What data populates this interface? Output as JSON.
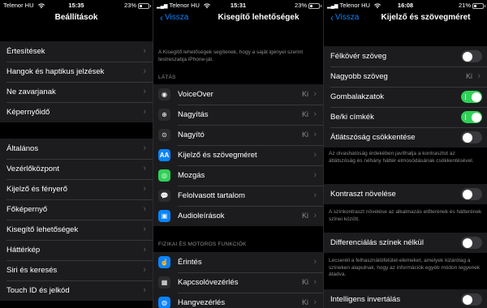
{
  "panel1": {
    "status": {
      "carrier": "Telenor HU",
      "time": "15:35",
      "battery": "23%",
      "battery_level": 0.23
    },
    "title": "Beállítások",
    "group1": [
      "Értesítések",
      "Hangok és haptikus jelzések",
      "Ne zavarjanak",
      "Képernyőidő"
    ],
    "group2": [
      "Általános",
      "Vezérlőközpont",
      "Kijelző és fényerő",
      "Főképernyő",
      "Kisegítő lehetőségek",
      "Háttérkép",
      "Siri és keresés",
      "Touch ID és jelkód"
    ]
  },
  "panel2": {
    "status": {
      "carrier": "Telenor HU",
      "time": "15:31",
      "battery": "23%",
      "battery_level": 0.23
    },
    "back": "Vissza",
    "title": "Kisegítő lehetőségek",
    "intro": "A Kisegítő lehetőségek segítenek, hogy a saját igényei szerint testreszabja iPhone-ját.",
    "section_vision": "LÁTÁS",
    "vision_items": [
      {
        "label": "VoiceOver",
        "value": "Ki",
        "icon": "voiceover-icon"
      },
      {
        "label": "Nagyítás",
        "value": "Ki",
        "icon": "zoom-icon"
      },
      {
        "label": "Nagyító",
        "value": "Ki",
        "icon": "magnifier-icon"
      },
      {
        "label": "Kijelző és szövegméret",
        "value": "",
        "icon": "text-size-icon"
      },
      {
        "label": "Mozgás",
        "value": "",
        "icon": "motion-icon"
      },
      {
        "label": "Felolvasott tartalom",
        "value": "",
        "icon": "speech-icon"
      },
      {
        "label": "Audioleírások",
        "value": "Ki",
        "icon": "audio-description-icon"
      }
    ],
    "section_motor": "FIZIKAI ÉS MOTOROS FUNKCIÓK",
    "motor_items": [
      {
        "label": "Érintés",
        "value": "",
        "icon": "touch-icon"
      },
      {
        "label": "Kapcsolóvezérlés",
        "value": "Ki",
        "icon": "switch-control-icon"
      },
      {
        "label": "Hangvezérlés",
        "value": "Ki",
        "icon": "voice-control-icon"
      }
    ]
  },
  "panel3": {
    "status": {
      "carrier": "Telenor HU",
      "time": "16:08",
      "battery": "21%",
      "battery_level": 0.21
    },
    "back": "Vissza",
    "title": "Kijelző és szövegméret",
    "group1": {
      "bold": {
        "label": "Félkövér szöveg",
        "on": false
      },
      "larger": {
        "label": "Nagyobb szöveg",
        "value": "Ki"
      },
      "button_shapes": {
        "label": "Gombalakzatok",
        "on": true
      },
      "onoff_labels": {
        "label": "Be/ki címkék",
        "on": true
      },
      "reduce_transparency": {
        "label": "Átlátszóság csökkentése",
        "on": false
      }
    },
    "desc_transparency": "Az olvashatóság érdekében javíthatja a kontrasztot az átlátszóság és néhány háttér elmosódásának csökkentésével.",
    "contrast": {
      "label": "Kontraszt növelése",
      "on": false
    },
    "desc_contrast": "A színkontraszt növelése az alkalmazás előterének és hátterének színei között.",
    "differentiate": {
      "label": "Differenciálás színek nélkül",
      "on": false
    },
    "desc_differentiate": "Lecseréli a felhasználóifelület-elemeket, amelyek kizárólag a színeken alapulnak, hogy az információk egyéb módon legyenek átadva.",
    "smart_invert": {
      "label": "Intelligens invertálás",
      "on": false
    }
  },
  "colors": {
    "accent": "#0a84ff",
    "toggle_on": "#30d158",
    "cell": "#1c1c1e",
    "background": "#000000"
  }
}
